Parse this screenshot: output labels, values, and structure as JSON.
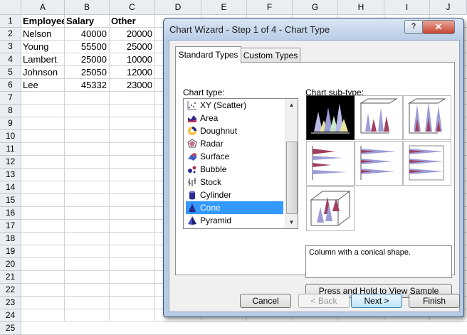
{
  "sheet": {
    "columns": [
      "A",
      "B",
      "C",
      "D",
      "E",
      "F",
      "G",
      "H",
      "I",
      "J"
    ],
    "rows": [
      "1",
      "2",
      "3",
      "4",
      "5",
      "6",
      "7",
      "8",
      "9",
      "10",
      "11",
      "12",
      "13",
      "14",
      "15",
      "16",
      "17",
      "18",
      "19",
      "20",
      "21",
      "22",
      "23",
      "24",
      "25"
    ],
    "headers": [
      "Employee",
      "Salary",
      "Other"
    ],
    "data": [
      [
        "Nelson",
        "40000",
        "20000"
      ],
      [
        "Young",
        "55500",
        "25000"
      ],
      [
        "Lambert",
        "25000",
        "10000"
      ],
      [
        "Johnson",
        "25050",
        "12000"
      ],
      [
        "Lee",
        "45332",
        "23000"
      ]
    ]
  },
  "dialog": {
    "title": "Chart Wizard - Step 1 of 4 - Chart Type",
    "help_label": "?",
    "close_label": "✕",
    "tabs": [
      "Standard Types",
      "Custom Types"
    ],
    "chart_type_label": "Chart type:",
    "chart_subtype_label": "Chart sub-type:",
    "chart_types": [
      {
        "label": "XY (Scatter)",
        "icon": "scatter-icon"
      },
      {
        "label": "Area",
        "icon": "area-icon"
      },
      {
        "label": "Doughnut",
        "icon": "doughnut-icon"
      },
      {
        "label": "Radar",
        "icon": "radar-icon"
      },
      {
        "label": "Surface",
        "icon": "surface-icon"
      },
      {
        "label": "Bubble",
        "icon": "bubble-icon"
      },
      {
        "label": "Stock",
        "icon": "stock-icon"
      },
      {
        "label": "Cylinder",
        "icon": "cylinder-icon"
      },
      {
        "label": "Cone",
        "icon": "cone-icon"
      },
      {
        "label": "Pyramid",
        "icon": "pyramid-icon"
      }
    ],
    "selected_chart_type": "Cone",
    "description": "Column with a conical shape.",
    "press_hold_label": "Press and Hold to View Sample",
    "buttons": {
      "cancel": "Cancel",
      "back": "< Back",
      "next": "Next >",
      "finish": "Finish"
    }
  }
}
